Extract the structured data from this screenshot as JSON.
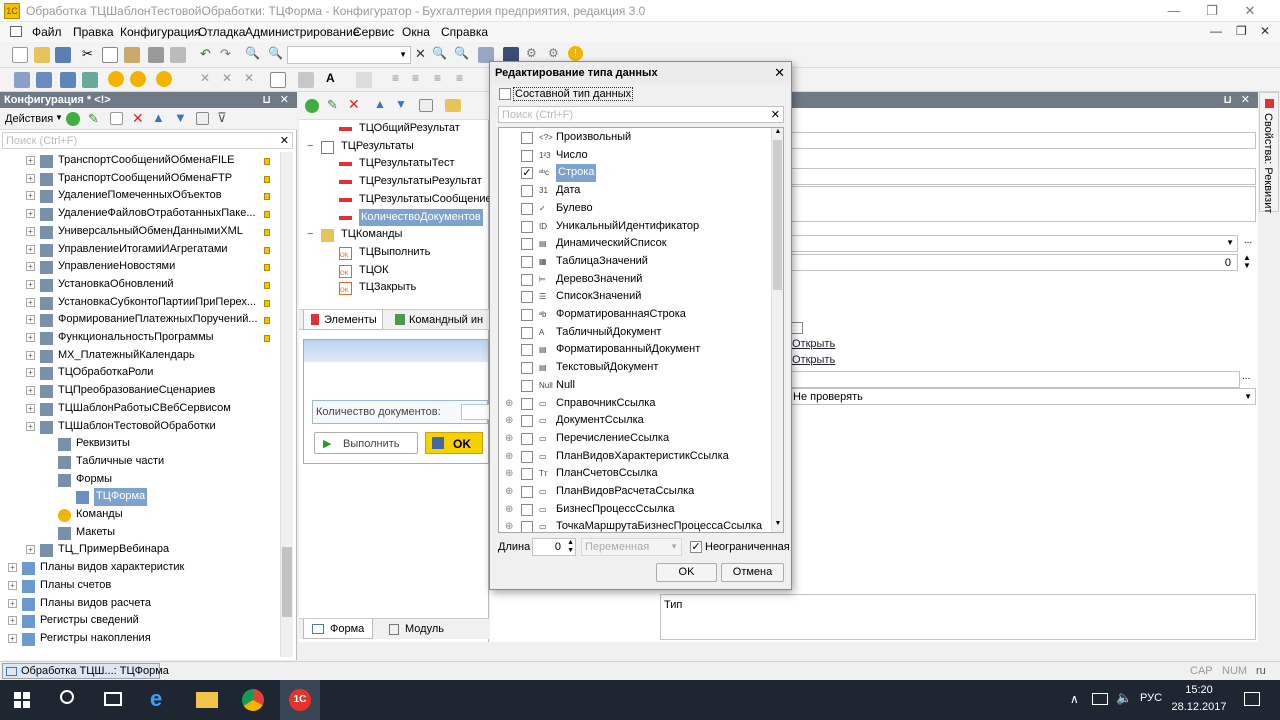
{
  "window": {
    "title": "Обработка ТЦШаблонТестовойОбработки: ТЦФорма - Конфигуратор - Бухгалтерия предприятия, редакция 3.0"
  },
  "menu": [
    "Файл",
    "Правка",
    "Конфигурация",
    "Отладка",
    "Администрирование",
    "Сервис",
    "Окна",
    "Справка"
  ],
  "config_panel": {
    "title": "Конфигурация * <!>",
    "actions_label": "Действия",
    "search_placeholder": "Поиск (Ctrl+F)",
    "items": [
      "ТранспортСообщенийОбменаFILE",
      "ТранспортСообщенийОбменаFTP",
      "УдалениеПомеченныхОбъектов",
      "УдалениеФайловОтработанныхПаке...",
      "УниверсальныйОбменДаннымиXML",
      "УправлениеИтогамиИАгрегатами",
      "УправлениеНовостями",
      "УстановкаОбновлений",
      "УстановкаСубконтоПартииПриПерех...",
      "ФормированиеПлатежныхПоручений...",
      "ФункциональностьПрограммы",
      "МХ_ПлатежныйКалендарь",
      "ТЦОбработкаРоли",
      "ТЦПреобразованиеСценариев",
      "ТЦШаблонРаботыСВебСервисом",
      "ТЦШаблонТестовойОбработки",
      "Реквизиты",
      "Табличные части",
      "Формы",
      "ТЦФорма",
      "Команды",
      "Макеты",
      "ТЦ_ПримерВебинара",
      "Планы видов характеристик",
      "Планы счетов",
      "Планы видов расчета",
      "Регистры сведений",
      "Регистры накопления"
    ]
  },
  "form_tree": {
    "items": [
      "ТЦОбщийРезультат",
      "ТЦРезультаты",
      "ТЦРезультатыТест",
      "ТЦРезультатыРезультат",
      "ТЦРезультатыСообщение",
      "КоличествоДокументов",
      "ТЦКоманды",
      "ТЦВыполнить",
      "ТЦОК",
      "ТЦЗакрыть"
    ],
    "tab_elements": "Элементы",
    "tab_commands": "Командный ин",
    "preview_label": "Количество документов:",
    "preview_run": "Выполнить",
    "preview_ok": "OK",
    "bottom_tab_form": "Форма",
    "bottom_tab_module": "Модуль"
  },
  "dialog": {
    "title": "Редактирование типа данных",
    "composite_label": "Составной тип данных",
    "search_placeholder": "Поиск (Ctrl+F)",
    "types": [
      {
        "label": "Произвольный",
        "checked": false,
        "expand": false
      },
      {
        "label": "Число",
        "checked": false,
        "expand": false
      },
      {
        "label": "Строка",
        "checked": true,
        "expand": false
      },
      {
        "label": "Дата",
        "checked": false,
        "expand": false
      },
      {
        "label": "Булево",
        "checked": false,
        "expand": false
      },
      {
        "label": "УникальныйИдентификатор",
        "checked": false,
        "expand": false
      },
      {
        "label": "ДинамическийСписок",
        "checked": false,
        "expand": false
      },
      {
        "label": "ТаблицаЗначений",
        "checked": false,
        "expand": false
      },
      {
        "label": "ДеревоЗначений",
        "checked": false,
        "expand": false
      },
      {
        "label": "СписокЗначений",
        "checked": false,
        "expand": false
      },
      {
        "label": "ФорматированнаяСтрока",
        "checked": false,
        "expand": false
      },
      {
        "label": "ТабличныйДокумент",
        "checked": false,
        "expand": false
      },
      {
        "label": "ФорматированныйДокумент",
        "checked": false,
        "expand": false
      },
      {
        "label": "ТекстовыйДокумент",
        "checked": false,
        "expand": false
      },
      {
        "label": "Null",
        "checked": false,
        "expand": false
      },
      {
        "label": "СправочникСсылка",
        "checked": false,
        "expand": true
      },
      {
        "label": "ДокументСсылка",
        "checked": false,
        "expand": true
      },
      {
        "label": "ПеречислениеСсылка",
        "checked": false,
        "expand": true
      },
      {
        "label": "ПланВидовХарактеристикСсылка",
        "checked": false,
        "expand": true
      },
      {
        "label": "ПланСчетовСсылка",
        "checked": false,
        "expand": true
      },
      {
        "label": "ПланВидовРасчетаСсылка",
        "checked": false,
        "expand": true
      },
      {
        "label": "БизнесПроцессСсылка",
        "checked": false,
        "expand": true
      },
      {
        "label": "ТочкаМаршрутаБизнесПроцессаСсылка",
        "checked": false,
        "expand": true
      }
    ],
    "length_label": "Длина",
    "length_value": "0",
    "variable_label": "Переменная",
    "unlimited_label": "Неограниченная",
    "ok_label": "OK",
    "cancel_label": "Отмена"
  },
  "props": {
    "side_tab": "Свойства: Реквизит",
    "number_value": "0",
    "link_open_1": "Открыть",
    "link_open_2": "Открыть",
    "check_value": "Не проверять",
    "type_label": "Тип"
  },
  "statusbar": {
    "window_tab": "Обработка ТЦШ...: ТЦФорма",
    "cap": "CAP",
    "num": "NUM",
    "lang": "ru"
  },
  "taskbar": {
    "lang": "РУС",
    "time": "15:20",
    "date": "28.12.2017"
  },
  "colors": {
    "selection": "#7da2ce",
    "panel_header": "#6f7a86",
    "taskbar": "#1e2631"
  }
}
